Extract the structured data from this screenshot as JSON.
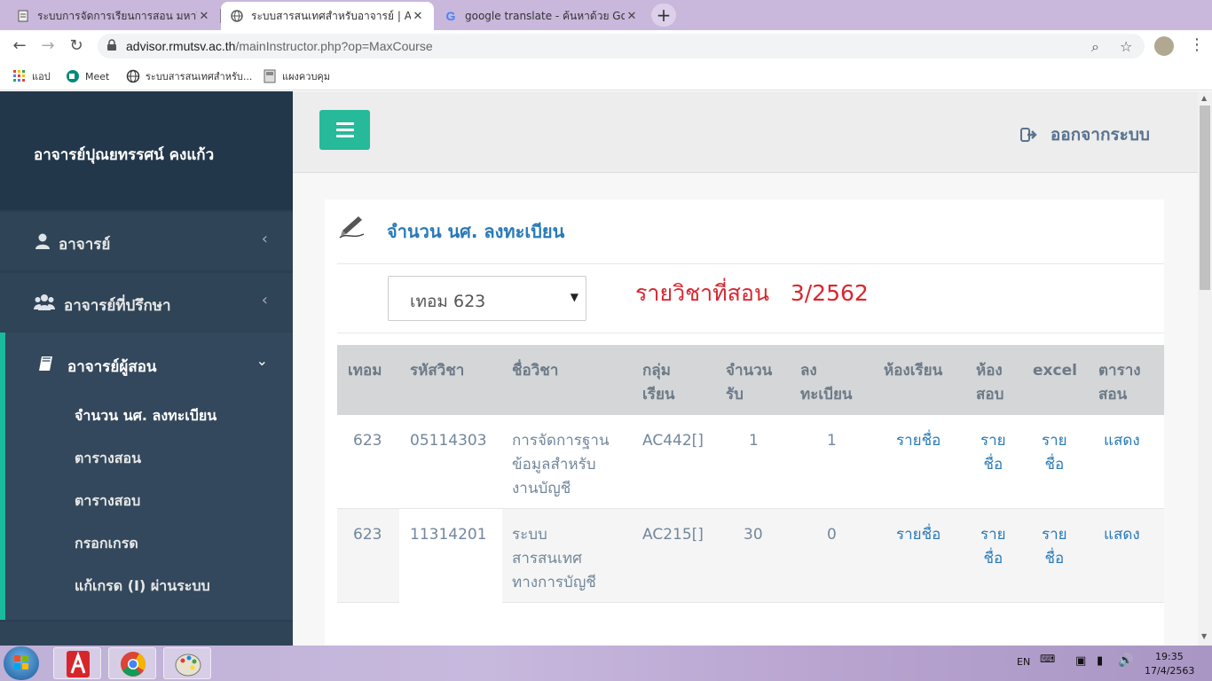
{
  "browser": {
    "tabs": [
      {
        "title": "ระบบการจัดการเรียนการสอน มหาวิทย",
        "active": false
      },
      {
        "title": "ระบบสารสนเทศสำหรับอาจารย์ | Advis",
        "active": true
      },
      {
        "title": "google translate - ค้นหาด้วย Goog",
        "active": false
      }
    ],
    "url_host": "advisor.rmutsv.ac.th",
    "url_path": "/mainInstructor.php?op=MaxCourse",
    "bookmarks": [
      "แอป",
      "Meet",
      "ระบบสารสนเทศสำหรับ...",
      "แผงควบคุม"
    ]
  },
  "sidebar": {
    "user_name": "อาจารย์ปุณยทรรศน์ คงแก้ว",
    "menu": [
      {
        "label": "อาจารย์",
        "icon": "user-icon"
      },
      {
        "label": "อาจารย์ที่ปรึกษา",
        "icon": "users-icon"
      },
      {
        "label": "อาจารย์ผู้สอน",
        "icon": "book-icon"
      }
    ],
    "submenu": [
      "จำนวน นศ. ลงทะเบียน",
      "ตารางสอน",
      "ตารางสอบ",
      "กรอกเกรด",
      "แก้เกรด (I) ผ่านระบบ"
    ]
  },
  "topbar": {
    "logout_label": "ออกจากระบบ"
  },
  "panel": {
    "title": "จำนวน นศ. ลงทะเบียน",
    "term_selected": "เทอม 623",
    "course_heading": "รายวิชาที่สอน   3/2562"
  },
  "table": {
    "headers": [
      [
        "เทอม"
      ],
      [
        "รหัสวิชา"
      ],
      [
        "ชื่อวิชา"
      ],
      [
        "กลุ่ม",
        "เรียน"
      ],
      [
        "จำนวน",
        "รับ"
      ],
      [
        "ลง",
        "ทะเบียน"
      ],
      [
        "ห้องเรียน"
      ],
      [
        "ห้อง",
        "สอบ"
      ],
      [
        "excel"
      ],
      [
        "ตาราง",
        "สอน"
      ]
    ],
    "rows": [
      {
        "term": "623",
        "code": "05114303",
        "name": [
          "การจัดการฐาน",
          "ข้อมูลสำหรับ",
          "งานบัญชี"
        ],
        "group": "AC442[]",
        "capacity": "1",
        "enrolled": "1",
        "room_link": "รายชื่อ",
        "exam_link": [
          "ราย",
          "ชื่อ"
        ],
        "excel_link": [
          "ราย",
          "ชื่อ"
        ],
        "schedule_link": "แสดง"
      },
      {
        "term": "623",
        "code": "11314201",
        "name": [
          "ระบบ",
          "สารสนเทศ",
          "ทางการบัญชี"
        ],
        "group": "AC215[]",
        "capacity": "30",
        "enrolled": "0",
        "room_link": "รายชื่อ",
        "exam_link": [
          "ราย",
          "ชื่อ"
        ],
        "excel_link": [
          "ราย",
          "ชื่อ"
        ],
        "schedule_link": "แสดง"
      }
    ]
  },
  "taskbar": {
    "lang": "EN",
    "time": "19:35",
    "date": "17/4/2563"
  },
  "colors": {
    "sidebar": "#2a3f54",
    "accent": "#26b99a",
    "link": "#2a7ab7",
    "heading_red": "#d9262f"
  }
}
